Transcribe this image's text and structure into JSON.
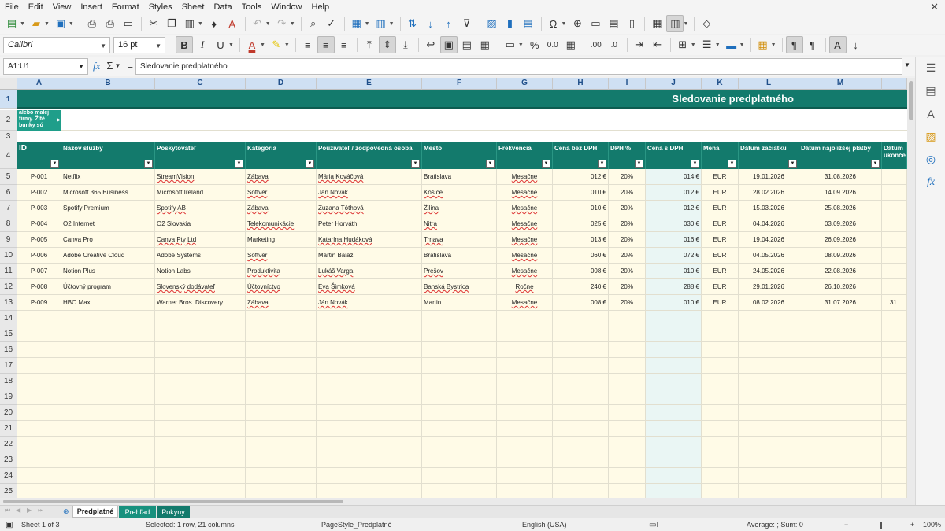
{
  "menu": [
    "File",
    "Edit",
    "View",
    "Insert",
    "Format",
    "Styles",
    "Sheet",
    "Data",
    "Tools",
    "Window",
    "Help"
  ],
  "font": {
    "name": "Calibri",
    "size": "16 pt"
  },
  "formula_bar": {
    "cell_ref": "A1:U1",
    "content": "Sledovanie predplatného"
  },
  "columns": [
    "A",
    "B",
    "C",
    "D",
    "E",
    "F",
    "G",
    "H",
    "I",
    "J",
    "K",
    "L",
    "M"
  ],
  "row_numbers": [
    "1",
    "2",
    "3",
    "4",
    "5",
    "6",
    "7",
    "8",
    "9",
    "10",
    "11",
    "12",
    "13",
    "14",
    "15",
    "16",
    "17",
    "18",
    "19",
    "20",
    "21",
    "22",
    "23",
    "24",
    "25"
  ],
  "title": "Sledovanie predplatného",
  "row2_note": "alebo malej firmy. Žlté bunky sú",
  "headers": [
    "ID",
    "Názov služby",
    "Poskytovateľ",
    "Kategória",
    "Používateľ / zodpovedná osoba",
    "Mesto",
    "Frekvencia",
    "Cena bez DPH",
    "DPH %",
    "Cena s DPH",
    "Mena",
    "Dátum začiatku",
    "Dátum najbližšej platby",
    "Dátum ukonče"
  ],
  "rows": [
    [
      "P-001",
      "Netflix",
      "StreamVision",
      "Zábava",
      "Mária Kováčová",
      "Bratislava",
      "Mesačne",
      "012 €",
      "20%",
      "014 €",
      "EUR",
      "19.01.2026",
      "31.08.2026",
      ""
    ],
    [
      "P-002",
      "Microsoft 365 Business",
      "Microsoft Ireland",
      "Softvér",
      "Ján Novák",
      "Košice",
      "Mesačne",
      "010 €",
      "20%",
      "012 €",
      "EUR",
      "28.02.2026",
      "14.09.2026",
      ""
    ],
    [
      "P-003",
      "Spotify Premium",
      "Spotify AB",
      "Zábava",
      "Zuzana Tóthová",
      "Žilina",
      "Mesačne",
      "010 €",
      "20%",
      "012 €",
      "EUR",
      "15.03.2026",
      "25.08.2026",
      ""
    ],
    [
      "P-004",
      "O2 Internet",
      "O2 Slovakia",
      "Telekomunikácie",
      "Peter Horváth",
      "Nitra",
      "Mesačne",
      "025 €",
      "20%",
      "030 €",
      "EUR",
      "04.04.2026",
      "03.09.2026",
      ""
    ],
    [
      "P-005",
      "Canva Pro",
      "Canva Pty Ltd",
      "Marketing",
      "Katarína Hudáková",
      "Trnava",
      "Mesačne",
      "013 €",
      "20%",
      "016 €",
      "EUR",
      "19.04.2026",
      "26.09.2026",
      ""
    ],
    [
      "P-006",
      "Adobe Creative Cloud",
      "Adobe Systems",
      "Softvér",
      "Martin Baláž",
      "Bratislava",
      "Mesačne",
      "060 €",
      "20%",
      "072 €",
      "EUR",
      "04.05.2026",
      "08.09.2026",
      ""
    ],
    [
      "P-007",
      "Notion Plus",
      "Notion Labs",
      "Produktivita",
      "Lukáš Varga",
      "Prešov",
      "Mesačne",
      "008 €",
      "20%",
      "010 €",
      "EUR",
      "24.05.2026",
      "22.08.2026",
      ""
    ],
    [
      "P-008",
      "Účtovný program",
      "Slovenský dodávateľ",
      "Účtovníctvo",
      "Eva Šimková",
      "Banská Bystrica",
      "Ročne",
      "240 €",
      "20%",
      "288 €",
      "EUR",
      "29.01.2026",
      "26.10.2026",
      ""
    ],
    [
      "P-009",
      "HBO Max",
      "Warner Bros. Discovery",
      "Zábava",
      "Ján Novák",
      "Martin",
      "Mesačne",
      "008 €",
      "20%",
      "010 €",
      "EUR",
      "08.02.2026",
      "31.07.2026",
      "31."
    ]
  ],
  "sheets": [
    "Predplatné",
    "Prehľad",
    "Pokyny"
  ],
  "status": {
    "sheet": "Sheet 1 of 3",
    "selection": "Selected: 1 row, 21 columns",
    "page_style": "PageStyle_Predplatné",
    "language": "English (USA)",
    "summary": "Average: ; Sum: 0",
    "zoom": "100%"
  },
  "colors": {
    "header_teal": "#137a6c",
    "note_teal": "#1f9e8a",
    "cell_bg": "#fffbe7",
    "highlight_col": "#eaf6f4"
  }
}
